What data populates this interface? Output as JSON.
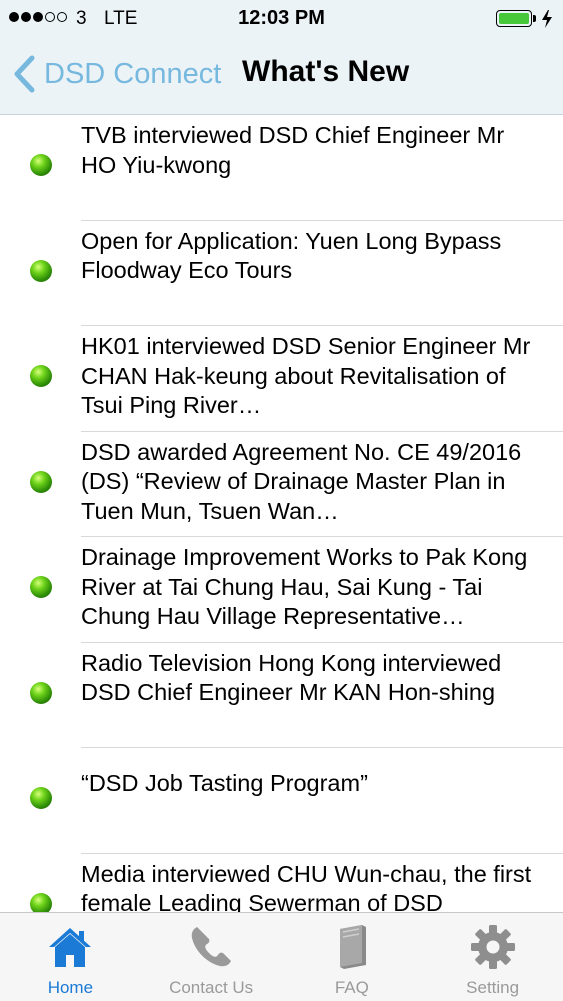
{
  "status_bar": {
    "carrier": "3",
    "network": "LTE",
    "time": "12:03 PM",
    "signal_strength": 3,
    "signal_max": 5,
    "battery_level": 1.0,
    "battery_color": "#46c83a",
    "charging": true
  },
  "nav": {
    "back_label": "DSD Connect",
    "title": "What's New",
    "accent_color": "#77b8df"
  },
  "news": [
    {
      "text": "TVB interviewed DSD Chief Engineer Mr HO Yiu-kwong"
    },
    {
      "text": "Open for Application: Yuen Long Bypass Floodway Eco Tours"
    },
    {
      "text": "HK01 interviewed DSD Senior Engineer Mr CHAN Hak-keung about Revitalisation of Tsui Ping River…"
    },
    {
      "text": "DSD awarded Agreement No. CE 49/2016 (DS) “Review of Drainage Master Plan in Tuen Mun, Tsuen Wan…"
    },
    {
      "text": "Drainage Improvement Works to Pak Kong River at Tai Chung Hau, Sai Kung - Tai Chung Hau Village Representative…"
    },
    {
      "text": "Radio Television Hong Kong interviewed DSD Chief Engineer Mr KAN Hon-shing"
    },
    {
      "text": "“DSD Job Tasting Program”"
    },
    {
      "text": "Media interviewed CHU Wun-chau, the first female Leading Sewerman of DSD"
    }
  ],
  "tabs": [
    {
      "label": "Home",
      "icon": "home-icon",
      "active": true
    },
    {
      "label": "Contact Us",
      "icon": "phone-icon",
      "active": false
    },
    {
      "label": "FAQ",
      "icon": "book-icon",
      "active": false
    },
    {
      "label": "Setting",
      "icon": "gear-icon",
      "active": false
    }
  ],
  "colors": {
    "tab_active": "#1a7ad6",
    "tab_inactive": "#9a9a9a",
    "bullet": "#3ea70f"
  }
}
